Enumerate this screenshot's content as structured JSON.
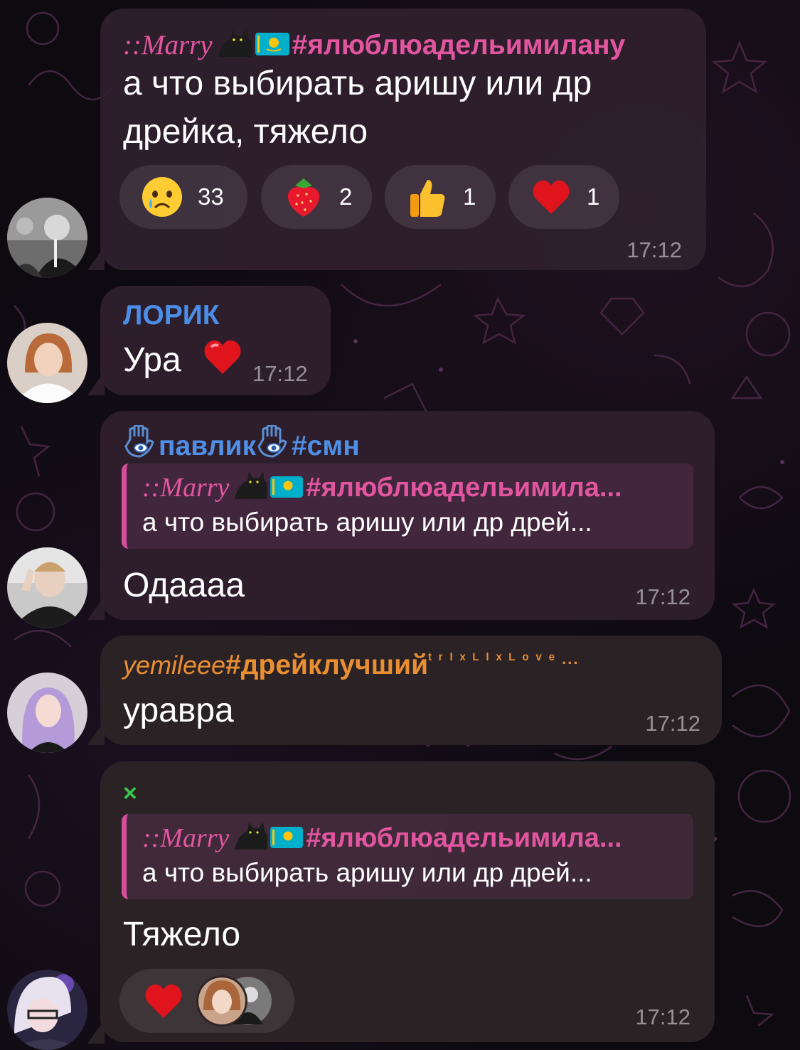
{
  "colors": {
    "background": "#0d0a10",
    "bubble": "#30202e",
    "marry_pink": "#e2569f",
    "lorik_blue": "#4b8ee8",
    "pavlik_blue": "#4f8fe6",
    "yemileee_orange": "#e98f32",
    "x_green": "#39c24a"
  },
  "messages": [
    {
      "sender": {
        "name": "::Marry",
        "icons": [
          "black-cat-emoji",
          "kazakhstan-flag-emoji"
        ],
        "hashtag": "#ялюблюадельимилану"
      },
      "text_line1": "а что выбирать аришу или др",
      "text_line2": "дрейка, тяжело",
      "reactions": [
        {
          "icon": "crying-face-emoji",
          "count": "33"
        },
        {
          "icon": "strawberry-emoji",
          "count": "2"
        },
        {
          "icon": "thumbs-up-emoji",
          "count": "1"
        },
        {
          "icon": "red-heart-emoji",
          "count": "1"
        }
      ],
      "time": "17:12"
    },
    {
      "sender": {
        "name": "ЛОРИК"
      },
      "text": "Ура",
      "icon": "red-heart-emoji",
      "time": "17:12"
    },
    {
      "sender": {
        "icons": [
          "hamsa-emoji",
          "hamsa-emoji"
        ],
        "name": "павлик",
        "hashtag": "#смн"
      },
      "reply": {
        "name": "::Marry",
        "hashtag": "#ялюблюадельимила...",
        "text": "а что выбирать аришу или др дрей..."
      },
      "text": "Одаааа",
      "time": "17:12"
    },
    {
      "sender": {
        "name": "yemileee",
        "hashtag": "#дрейклучший",
        "suffix": "ᵗʳᶦˣˡᶦˣ ˡᵒᵛᵉ...",
        "suffix_display": "ᵗ ʳ ᴵ ˣ ᴸ ᴵ ˣ  ᴸ ᵒ ᵛ ᵉ ..."
      },
      "text": "уравра",
      "time": "17:12"
    },
    {
      "sender": {
        "name": "×"
      },
      "reply": {
        "name": "::Marry",
        "hashtag": "#ялюблюадельимила...",
        "text": "а что выбирать аришу или др дрей..."
      },
      "text": "Тяжело",
      "reactions": [
        {
          "icon": "red-heart-emoji",
          "reactor_avatars": [
            "avatar-girl",
            "avatar-man"
          ]
        }
      ],
      "time": "17:12"
    }
  ]
}
